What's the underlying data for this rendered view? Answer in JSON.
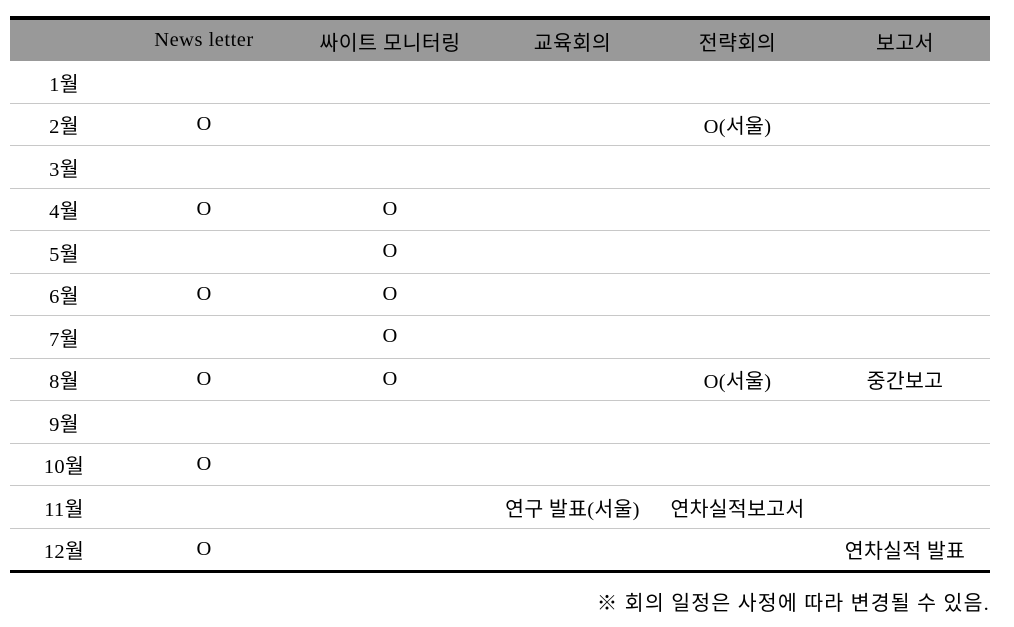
{
  "table": {
    "columns": [
      {
        "key": "month",
        "label": ""
      },
      {
        "key": "news",
        "label": "News letter"
      },
      {
        "key": "site",
        "label": "싸이트 모니터링"
      },
      {
        "key": "edu",
        "label": "교육회의"
      },
      {
        "key": "strat",
        "label": "전략회의"
      },
      {
        "key": "report",
        "label": "보고서"
      }
    ],
    "rows": [
      {
        "month": "1월",
        "news": "",
        "site": "",
        "edu": "",
        "strat": "",
        "report": ""
      },
      {
        "month": "2월",
        "news": "O",
        "site": "",
        "edu": "",
        "strat": "O(서울)",
        "report": ""
      },
      {
        "month": "3월",
        "news": "",
        "site": "",
        "edu": "",
        "strat": "",
        "report": ""
      },
      {
        "month": "4월",
        "news": "O",
        "site": "O",
        "edu": "",
        "strat": "",
        "report": ""
      },
      {
        "month": "5월",
        "news": "",
        "site": "O",
        "edu": "",
        "strat": "",
        "report": ""
      },
      {
        "month": "6월",
        "news": "O",
        "site": "O",
        "edu": "",
        "strat": "",
        "report": ""
      },
      {
        "month": "7월",
        "news": "",
        "site": "O",
        "edu": "",
        "strat": "",
        "report": ""
      },
      {
        "month": "8월",
        "news": "O",
        "site": "O",
        "edu": "",
        "strat": "O(서울)",
        "report": "중간보고"
      },
      {
        "month": "9월",
        "news": "",
        "site": "",
        "edu": "",
        "strat": "",
        "report": ""
      },
      {
        "month": "10월",
        "news": "O",
        "site": "",
        "edu": "",
        "strat": "",
        "report": ""
      },
      {
        "month": "11월",
        "news": "",
        "site": "",
        "edu": "연구 발표(서울)",
        "strat": "연차실적보고서",
        "report": ""
      },
      {
        "month": "12월",
        "news": "O",
        "site": "",
        "edu": "",
        "strat": "",
        "report": "연차실적 발표"
      }
    ]
  },
  "footnote": "※ 회의 일정은 사정에 따라 변경될 수 있음.",
  "colors": {
    "header_background": "#999999",
    "border_strong": "#000000",
    "border_light": "#c8c8c8",
    "text": "#000000"
  }
}
